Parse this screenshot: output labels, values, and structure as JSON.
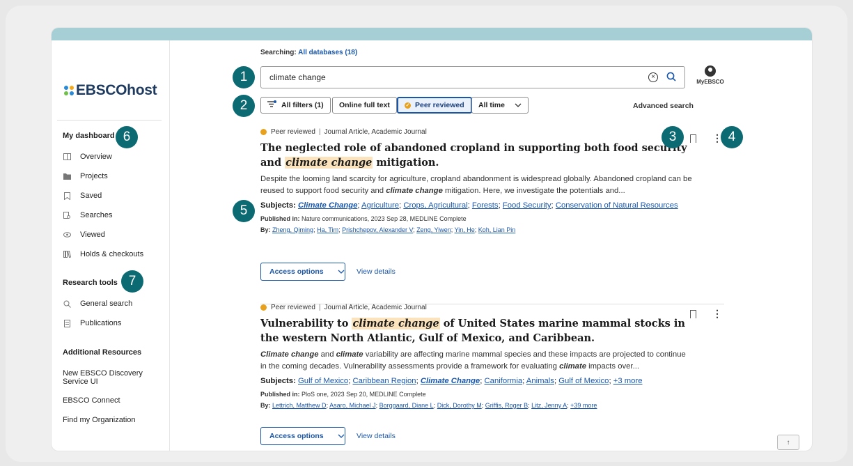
{
  "app": {
    "logo_text": "EBSCOhost"
  },
  "sidebar": {
    "dashboard_heading": "My dashboard",
    "dashboard_items": [
      {
        "label": "Overview",
        "icon": "columns-icon"
      },
      {
        "label": "Projects",
        "icon": "folder-icon"
      },
      {
        "label": "Saved",
        "icon": "bookmark-icon"
      },
      {
        "label": "Searches",
        "icon": "search-history-icon"
      },
      {
        "label": "Viewed",
        "icon": "eye-icon"
      },
      {
        "label": "Holds & checkouts",
        "icon": "books-icon"
      }
    ],
    "research_heading": "Research tools",
    "research_items": [
      {
        "label": "General search",
        "icon": "search-icon"
      },
      {
        "label": "Publications",
        "icon": "document-icon"
      }
    ],
    "additional_heading": "Additional Resources",
    "additional_items": [
      "New EBSCO Discovery Service UI",
      "EBSCO Connect",
      "Find my Organization"
    ]
  },
  "search": {
    "searching_label": "Searching:",
    "searching_value": "All databases (18)",
    "query": "climate change",
    "account_label": "MyEBSCO"
  },
  "filters": {
    "all_filters": "All filters (1)",
    "online_full_text": "Online full text",
    "peer_reviewed": "Peer reviewed",
    "time": "All time",
    "advanced_search": "Advanced search"
  },
  "results": [
    {
      "meta_status": "Peer reviewed",
      "meta_type": "Journal Article, Academic Journal",
      "title_before": "The neglected role of abandoned cropland in supporting both food security and ",
      "title_highlight": "climate change",
      "title_after": " mitigation.",
      "abstract_before": "Despite the looming land scarcity for agriculture, cropland abandonment is widespread globally. Abandoned cropland can be reused to support food security and ",
      "abstract_highlight": "climate change",
      "abstract_after": " mitigation. Here, we investigate the potentials and...",
      "subjects_label": "Subjects:",
      "subjects": [
        "Climate Change",
        "Agriculture",
        "Crops, Agricultural",
        "Forests",
        "Food Security",
        "Conservation of Natural Resources"
      ],
      "published_label": "Published in:",
      "published": "Nature communications, 2023 Sep 28, MEDLINE Complete",
      "by_label": "By:",
      "authors": [
        "Zheng, Qiming",
        "Ha, Tim",
        "Prishchepov, Alexander V",
        "Zeng, Yiwen",
        "Yin, He",
        "Koh, Lian Pin"
      ],
      "access_label": "Access options",
      "view_details": "View details"
    },
    {
      "meta_status": "Peer reviewed",
      "meta_type": "Journal Article, Academic Journal",
      "title_before": "Vulnerability to ",
      "title_highlight": "climate change",
      "title_after": " of United States marine mammal stocks in the western North Atlantic, Gulf of Mexico, and Caribbean.",
      "abstract_b1": "Climate change",
      "abstract_t1": " and ",
      "abstract_b2": "climate",
      "abstract_t2": " variability are affecting marine mammal species and these impacts are projected to continue in the coming decades. Vulnerability assessments provide a framework for evaluating ",
      "abstract_b3": "climate",
      "abstract_t3": " impacts over...",
      "subjects_label": "Subjects:",
      "subjects": [
        "Gulf of Mexico",
        "Caribbean Region",
        "Climate Change",
        "Caniformia",
        "Animals",
        "Gulf of Mexico",
        "+3 more"
      ],
      "published_label": "Published in:",
      "published": "PloS one, 2023 Sep 20, MEDLINE Complete",
      "by_label": "By:",
      "authors": [
        "Lettrich, Matthew D",
        "Asaro, Michael J",
        "Borggaard, Diane L",
        "Dick, Dorothy M",
        "Griffis, Roger B",
        "Litz, Jenny A",
        "+39 more"
      ],
      "access_label": "Access options",
      "view_details": "View details"
    }
  ],
  "callouts": [
    "1",
    "2",
    "3",
    "4",
    "5",
    "6",
    "7"
  ],
  "colors": {
    "accent": "#1a56a8",
    "callout": "#0c6a73",
    "highlight": "#fbe4bd",
    "peer_dot": "#e7a11d",
    "topbar": "#a6cfd5"
  }
}
